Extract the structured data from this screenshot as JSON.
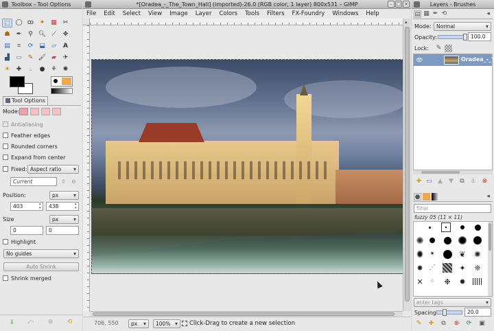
{
  "toolbox": {
    "title": "Toolbox - Tool Options",
    "tool_options_tab": "Tool Options",
    "mode_label": "Mode:",
    "antialiasing": "Antialiasing",
    "feather_edges": "Feather edges",
    "rounded_corners": "Rounded corners",
    "expand_from_center": "Expand from center",
    "fixed_label": "Fixed:",
    "fixed_value": "Aspect ratio",
    "current_value": "Current",
    "position_label": "Position:",
    "position_unit": "px",
    "position_x": "403",
    "position_y": "438",
    "size_label": "Size",
    "size_unit": "px",
    "size_w": "0",
    "size_h": "0",
    "highlight": "Highlight",
    "guides_value": "No guides",
    "auto_shrink": "Auto Shrink",
    "shrink_merged": "Shrink merged"
  },
  "gimp": {
    "title": "*[Oradea_-_The_Town_Hall] (imported)-26.0 (RGB color, 1 layer) 800x531 – GIMP",
    "menus": [
      "File",
      "Edit",
      "Select",
      "View",
      "Image",
      "Layer",
      "Colors",
      "Tools",
      "Filters",
      "FX-Foundry",
      "Windows",
      "Help"
    ],
    "status": {
      "coords": "706, 550",
      "unit": "px",
      "zoom": "100%",
      "message": "Click-Drag to create a new selection"
    }
  },
  "layers": {
    "title": "Layers - Brushes",
    "mode_label": "Mode:",
    "mode_value": "Normal",
    "opacity_label": "Opacity:",
    "opacity_value": "100.0",
    "lock_label": "Lock:",
    "layer_name": "Oradea_-_T",
    "filter_placeholder": "filter",
    "brush_name": "fuzzy 05 (11 × 11)",
    "tags_placeholder": "enter tags",
    "spacing_label": "Spacing:",
    "spacing_value": "20.0"
  },
  "colors": {
    "accent": "#cfe0f5",
    "selected_row": "#7d9ac2",
    "sky": "#4a5a78"
  }
}
